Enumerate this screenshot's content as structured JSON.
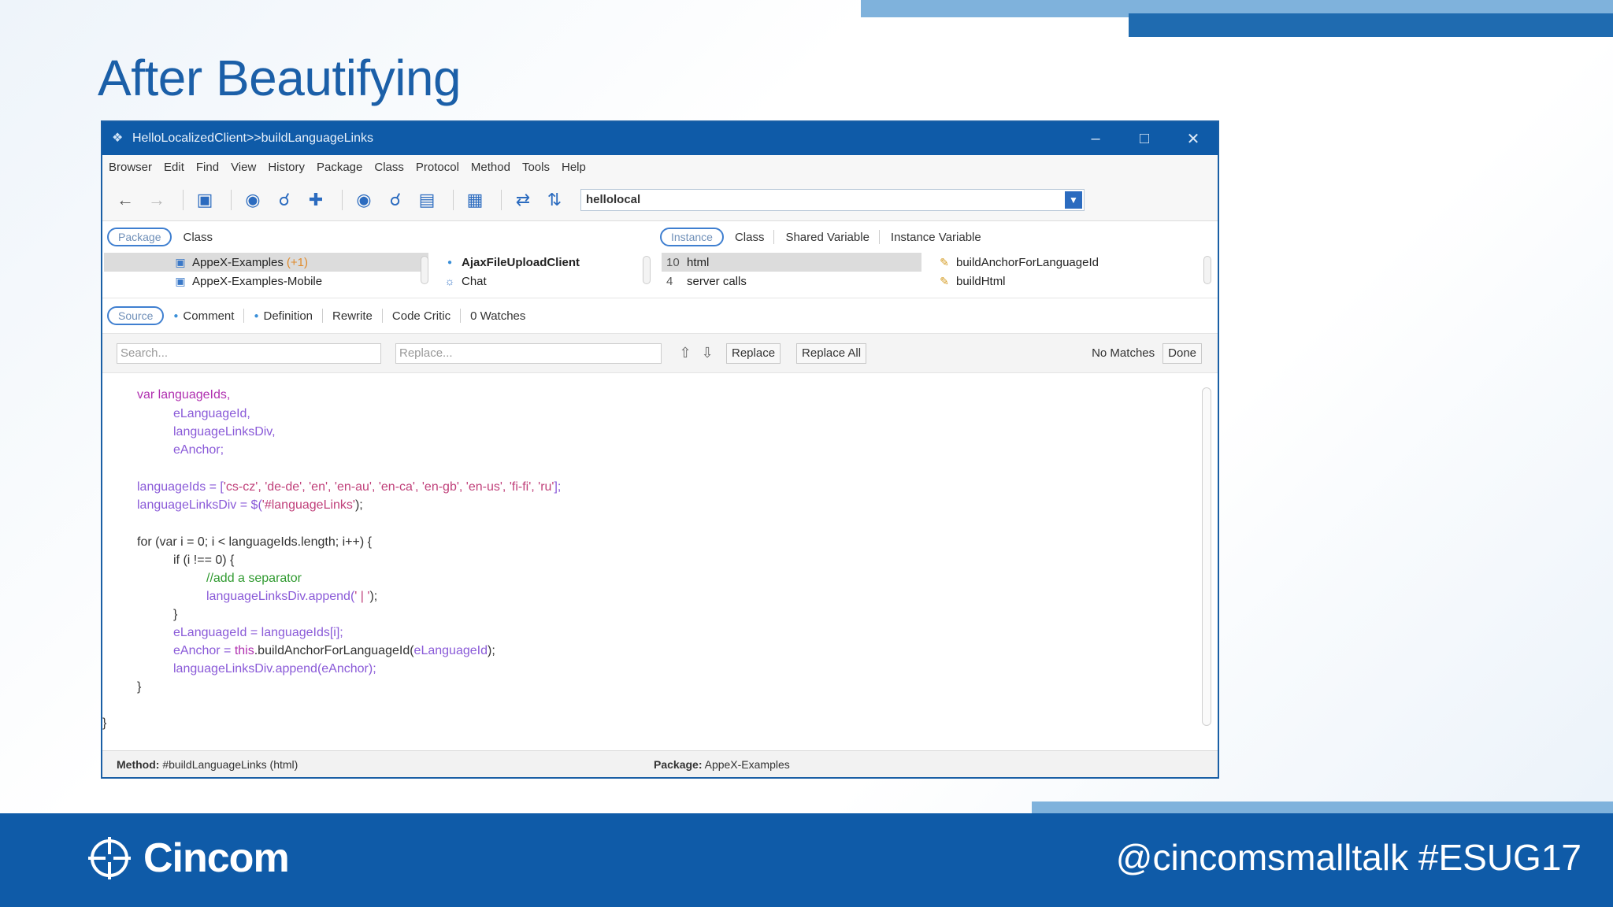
{
  "slide": {
    "title": "After Beautifying",
    "logo_text": "Cincom",
    "hashtag": "@cincomsmalltalk #ESUG17",
    "colors": {
      "title": "#1b5fa8",
      "footer": "#0f5ba8",
      "accent_light": "#7fb2dc"
    }
  },
  "window": {
    "title": "HelloLocalizedClient>>buildLanguageLinks",
    "controls": [
      "–",
      "□",
      "✕"
    ]
  },
  "menu": [
    "Browser",
    "Edit",
    "Find",
    "View",
    "History",
    "Package",
    "Class",
    "Protocol",
    "Method",
    "Tools",
    "Help"
  ],
  "toolbar": {
    "search_value": "hellolocal"
  },
  "nav_tabs": {
    "left": {
      "active": "Package",
      "other": "Class"
    },
    "right": {
      "active": "Instance",
      "others": [
        "Class",
        "Shared Variable",
        "Instance Variable"
      ]
    }
  },
  "panes": {
    "packages": [
      {
        "name": "AppeX-Examples",
        "suffix": "(+1)"
      },
      {
        "name": "AppeX-Examples-Mobile",
        "suffix": ""
      }
    ],
    "classes": [
      "AjaxFileUploadClient",
      "Chat"
    ],
    "protocols": [
      {
        "count": "10",
        "name": "html"
      },
      {
        "count": "4",
        "name": "server calls"
      }
    ],
    "methods": [
      "buildAnchorForLanguageId",
      "buildHtml"
    ]
  },
  "source_tabs": {
    "active": "Source",
    "others": [
      "Comment",
      "Definition",
      "Rewrite",
      "Code Critic",
      "0 Watches"
    ]
  },
  "find": {
    "search_placeholder": "Search...",
    "replace_placeholder": "Replace...",
    "replace_label": "Replace",
    "replace_all_label": "Replace All",
    "status": "No Matches",
    "done_label": "Done"
  },
  "code": {
    "l1": "var languageIds,",
    "l2": "eLanguageId,",
    "l3": "languageLinksDiv,",
    "l4": "eAnchor;",
    "l5a": "languageIds = [",
    "l5b": "'cs-cz', 'de-de', 'en', 'en-au', 'en-ca', 'en-gb', 'en-us', 'fi-fi', 'ru'",
    "l5c": "];",
    "l6a": "languageLinksDiv = $(",
    "l6b": "'#languageLinks'",
    "l6c": ");",
    "l7": "for (var i = 0; i < languageIds.length; i++) {",
    "l8": "if (i !== 0) {",
    "l9": "//add a separator",
    "l10a": "languageLinksDiv.append(",
    "l10b": "' | '",
    "l10c": ");",
    "l11": "}",
    "l12": "eLanguageId = languageIds[i];",
    "l13a": "eAnchor = ",
    "l13b": "this",
    "l13c": ".buildAnchorForLanguageId(",
    "l13d": "eLanguageId",
    "l13e": ");",
    "l14": "languageLinksDiv.append(eAnchor);",
    "l15": "}",
    "l16": "}"
  },
  "status": {
    "method_label": "Method:",
    "method_value": "#buildLanguageLinks (html)",
    "package_label": "Package:",
    "package_value": "AppeX-Examples"
  },
  "icons": [
    "back-arrow-icon",
    "forward-arrow-icon",
    "browser-icon",
    "binoculars-icon",
    "magnify-icon",
    "add-icon",
    "sync-icon",
    "refresh-icon"
  ]
}
